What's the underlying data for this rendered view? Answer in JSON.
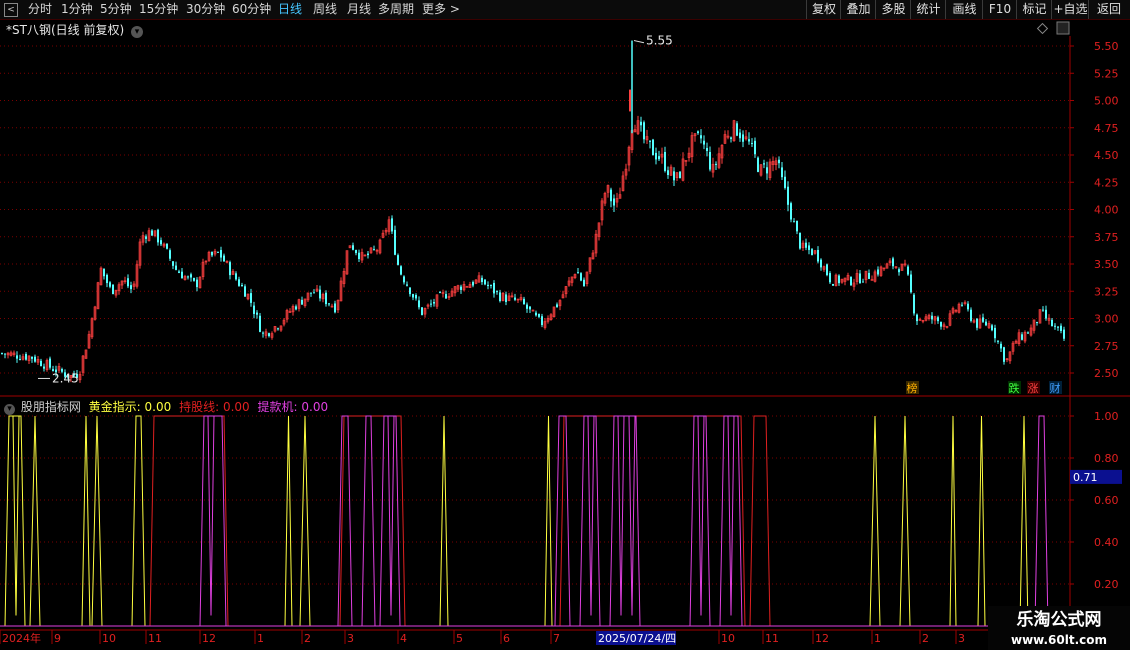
{
  "toolbar": {
    "items": [
      "分时",
      "1分钟",
      "5分钟",
      "15分钟",
      "30分钟",
      "60分钟",
      "日线",
      "周线",
      "月线",
      "多周期",
      "更多 >"
    ],
    "active": "日线",
    "right_buttons": [
      "复权",
      "叠加",
      "多股",
      "统计",
      "画线",
      "F10",
      "标记",
      "+自选",
      "返回"
    ]
  },
  "chart": {
    "title": "*ST八钢(日线 前复权)",
    "high_label": "5.55",
    "low_label": "2.45",
    "markers": {
      "bang": "榜",
      "die": "跌",
      "zhang": "涨",
      "cai": "财"
    },
    "price_ticks": [
      "5.50",
      "5.25",
      "5.00",
      "4.75",
      "4.50",
      "4.25",
      "4.00",
      "3.75",
      "3.50",
      "3.25",
      "3.00",
      "2.75",
      "2.50"
    ]
  },
  "indicator": {
    "name": "股朋指标网",
    "gold_label": "黄金指示:",
    "gold_value": "0.00",
    "hold_label": "持股线:",
    "hold_value": "0.00",
    "alarm_label": "提款机:",
    "alarm_value": "0.00",
    "ticks": [
      "1.00",
      "0.80",
      "0.60",
      "0.40",
      "0.20"
    ],
    "cursor_value": "0.71"
  },
  "x_axis": {
    "labels": [
      "2024年",
      "9",
      "10",
      "11",
      "12",
      "1",
      "2",
      "3",
      "4",
      "5",
      "6",
      "7",
      "10",
      "11",
      "12",
      "1",
      "2",
      "3"
    ],
    "cursor_date": "2025/07/24/四"
  },
  "watermark": {
    "line1": "乐淘公式网",
    "line2": "www.60lt.com"
  },
  "colors": {
    "bg": "#000000",
    "up": "#ff4040",
    "down": "#54ffff",
    "grid": "#7a0000",
    "gold": "#ffff40",
    "hold": "#e02020",
    "alarm": "#e040e0",
    "active_tab": "#46c6ff"
  },
  "chart_data": [
    {
      "type": "candlestick",
      "title": "*ST八钢(日线 前复权)",
      "x": [
        "2024年",
        "9",
        "10",
        "11",
        "12",
        "1",
        "2",
        "3",
        "4",
        "5",
        "6",
        "7",
        "10",
        "11",
        "12",
        "1",
        "2",
        "3"
      ],
      "y_ticks": [
        2.5,
        2.75,
        3.0,
        3.25,
        3.5,
        3.75,
        4.0,
        4.25,
        4.5,
        4.75,
        5.0,
        5.25,
        5.5
      ],
      "ylim": [
        2.4,
        5.6
      ],
      "close_path": [
        [
          0,
          2.68
        ],
        [
          30,
          2.65
        ],
        [
          50,
          2.55
        ],
        [
          70,
          2.47
        ],
        [
          78,
          2.5
        ],
        [
          88,
          2.85
        ],
        [
          100,
          3.45
        ],
        [
          110,
          3.25
        ],
        [
          122,
          3.35
        ],
        [
          132,
          3.25
        ],
        [
          140,
          3.75
        ],
        [
          150,
          3.8
        ],
        [
          160,
          3.7
        ],
        [
          175,
          3.45
        ],
        [
          195,
          3.3
        ],
        [
          205,
          3.55
        ],
        [
          218,
          3.6
        ],
        [
          232,
          3.4
        ],
        [
          248,
          3.2
        ],
        [
          262,
          2.85
        ],
        [
          278,
          2.95
        ],
        [
          292,
          3.1
        ],
        [
          312,
          3.25
        ],
        [
          335,
          3.1
        ],
        [
          348,
          3.7
        ],
        [
          362,
          3.55
        ],
        [
          378,
          3.65
        ],
        [
          388,
          3.9
        ],
        [
          398,
          3.45
        ],
        [
          410,
          3.25
        ],
        [
          420,
          3.05
        ],
        [
          440,
          3.2
        ],
        [
          460,
          3.3
        ],
        [
          480,
          3.35
        ],
        [
          500,
          3.2
        ],
        [
          520,
          3.15
        ],
        [
          540,
          2.95
        ],
        [
          558,
          3.15
        ],
        [
          575,
          3.45
        ],
        [
          583,
          3.3
        ],
        [
          595,
          3.75
        ],
        [
          605,
          4.2
        ],
        [
          615,
          4.0
        ],
        [
          625,
          4.45
        ],
        [
          632,
          4.85
        ],
        [
          645,
          4.6
        ],
        [
          662,
          4.45
        ],
        [
          675,
          4.25
        ],
        [
          690,
          4.6
        ],
        [
          700,
          4.65
        ],
        [
          712,
          4.35
        ],
        [
          725,
          4.7
        ],
        [
          735,
          4.75
        ],
        [
          748,
          4.6
        ],
        [
          760,
          4.35
        ],
        [
          775,
          4.45
        ],
        [
          790,
          3.95
        ],
        [
          800,
          3.65
        ],
        [
          815,
          3.6
        ],
        [
          830,
          3.35
        ],
        [
          850,
          3.35
        ],
        [
          870,
          3.4
        ],
        [
          890,
          3.5
        ],
        [
          905,
          3.45
        ],
        [
          915,
          3.0
        ],
        [
          930,
          3.0
        ],
        [
          945,
          2.95
        ],
        [
          960,
          3.15
        ],
        [
          975,
          2.95
        ],
        [
          990,
          2.95
        ],
        [
          1005,
          2.6
        ],
        [
          1015,
          2.8
        ],
        [
          1030,
          2.9
        ],
        [
          1040,
          3.05
        ],
        [
          1055,
          2.9
        ],
        [
          1064,
          2.8
        ]
      ]
    },
    {
      "type": "line",
      "title": "股朋指标网",
      "y_ticks": [
        0.2,
        0.4,
        0.6,
        0.8,
        1.0
      ],
      "ylim": [
        0,
        1.05
      ],
      "series": [
        {
          "name": "黄金指示",
          "pulses": [
            [
              5,
              25
            ],
            [
              30,
              40
            ],
            [
              82,
              90
            ],
            [
              92,
              102
            ],
            [
              132,
              145
            ],
            [
              285,
              292
            ],
            [
              300,
              310
            ],
            [
              440,
              448
            ],
            [
              545,
              552
            ],
            [
              870,
              880
            ],
            [
              900,
              910
            ],
            [
              950,
              956
            ],
            [
              978,
              985
            ],
            [
              1020,
              1028
            ]
          ],
          "base": 0
        },
        {
          "name": "持股线",
          "pulses": [
            [
              150,
              228
            ],
            [
              340,
              405
            ],
            [
              560,
              745
            ],
            [
              750,
              770
            ]
          ],
          "base": 0
        },
        {
          "name": "提款机",
          "pulses": [
            [
              200,
              226
            ],
            [
              338,
              352
            ],
            [
              362,
              375
            ],
            [
              380,
              400
            ],
            [
              555,
              570
            ],
            [
              580,
              600
            ],
            [
              610,
              640
            ],
            [
              690,
              710
            ],
            [
              720,
              742
            ],
            [
              1035,
              1048
            ]
          ],
          "base": 0
        }
      ]
    }
  ]
}
